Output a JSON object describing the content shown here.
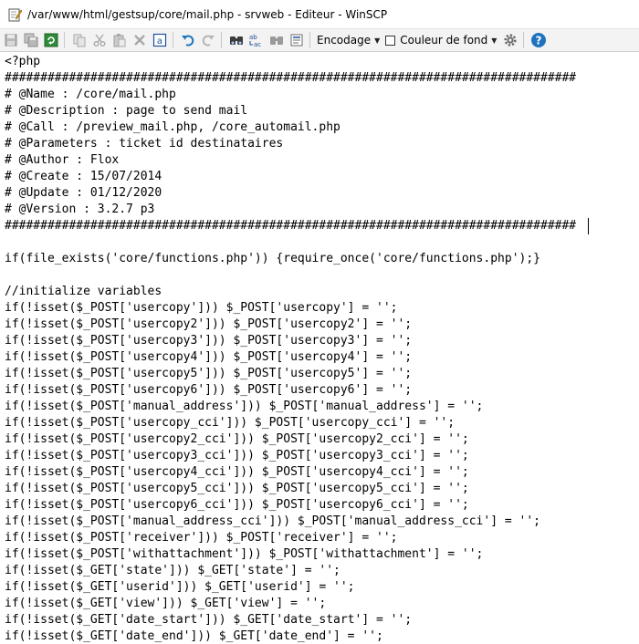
{
  "window": {
    "title": "/var/www/html/gestsup/core/mail.php - srvweb - Editeur - WinSCP"
  },
  "toolbar": {
    "icons": [
      "save-icon",
      "save-all-icon",
      "refresh-icon",
      "copy-icon",
      "cut-icon",
      "paste-icon",
      "delete-icon",
      "select-all-icon",
      "undo-icon",
      "redo-icon",
      "find-icon",
      "replace-icon",
      "find-next-icon",
      "goto-line-icon",
      "settings-icon",
      "help-icon"
    ],
    "encoding_label": "Encodage",
    "background_label": "Couleur de fond",
    "accent_color": "#1e73be"
  },
  "editor": {
    "lines": [
      "<?php",
      "################################################################################",
      "# @Name : /core/mail.php",
      "# @Description : page to send mail",
      "# @Call : /preview_mail.php, /core_automail.php",
      "# @Parameters : ticket id destinataires",
      "# @Author : Flox",
      "# @Create : 15/07/2014",
      "# @Update : 01/12/2020",
      "# @Version : 3.2.7 p3",
      "################################################################################",
      "",
      "if(file_exists('core/functions.php')) {require_once('core/functions.php');}",
      "",
      "//initialize variables",
      "if(!isset($_POST['usercopy'])) $_POST['usercopy'] = '';",
      "if(!isset($_POST['usercopy2'])) $_POST['usercopy2'] = '';",
      "if(!isset($_POST['usercopy3'])) $_POST['usercopy3'] = '';",
      "if(!isset($_POST['usercopy4'])) $_POST['usercopy4'] = '';",
      "if(!isset($_POST['usercopy5'])) $_POST['usercopy5'] = '';",
      "if(!isset($_POST['usercopy6'])) $_POST['usercopy6'] = '';",
      "if(!isset($_POST['manual_address'])) $_POST['manual_address'] = '';",
      "if(!isset($_POST['usercopy_cci'])) $_POST['usercopy_cci'] = '';",
      "if(!isset($_POST['usercopy2_cci'])) $_POST['usercopy2_cci'] = '';",
      "if(!isset($_POST['usercopy3_cci'])) $_POST['usercopy3_cci'] = '';",
      "if(!isset($_POST['usercopy4_cci'])) $_POST['usercopy4_cci'] = '';",
      "if(!isset($_POST['usercopy5_cci'])) $_POST['usercopy5_cci'] = '';",
      "if(!isset($_POST['usercopy6_cci'])) $_POST['usercopy6_cci'] = '';",
      "if(!isset($_POST['manual_address_cci'])) $_POST['manual_address_cci'] = '';",
      "if(!isset($_POST['receiver'])) $_POST['receiver'] = '';",
      "if(!isset($_POST['withattachment'])) $_POST['withattachment'] = '';",
      "if(!isset($_GET['state'])) $_GET['state'] = '';",
      "if(!isset($_GET['userid'])) $_GET['userid'] = '';",
      "if(!isset($_GET['view'])) $_GET['view'] = '';",
      "if(!isset($_GET['date_start'])) $_GET['date_start'] = '';",
      "if(!isset($_GET['date_end'])) $_GET['date_end'] = '';"
    ]
  }
}
